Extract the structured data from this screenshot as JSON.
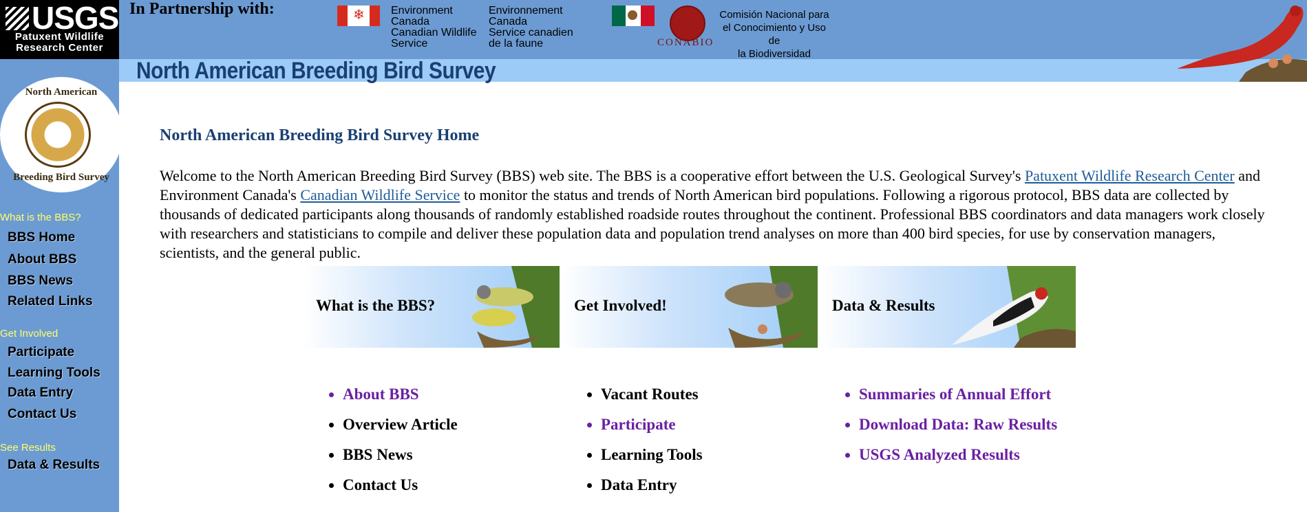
{
  "header": {
    "usgs_logo": "USGS",
    "usgs_sub1": "Patuxent Wildlife",
    "usgs_sub2": "Research Center",
    "partnership": "In Partnership with:",
    "env_canada_en": [
      "Environment",
      "Canada",
      "Canadian Wildlife",
      "Service"
    ],
    "env_canada_fr": [
      "Environnement",
      "Canada",
      "Service canadien",
      "de la faune"
    ],
    "conabio": "CONABIO",
    "comision": [
      "Comisión Nacional para",
      "el Conocimiento y Uso de",
      "la Biodiversidad"
    ],
    "site_title": "North American Breeding Bird Survey"
  },
  "sidebar": {
    "logo_top": "North American",
    "logo_bottom": "Breeding Bird Survey",
    "sections": [
      {
        "heading": "What is the BBS?",
        "items": [
          "BBS Home",
          "About BBS",
          "BBS News",
          "Related Links"
        ]
      },
      {
        "heading": "Get Involved",
        "items": [
          "Participate",
          "Learning Tools",
          "Data Entry",
          "Contact Us"
        ]
      },
      {
        "heading": "See Results",
        "items": [
          "Data & Results"
        ]
      }
    ]
  },
  "main": {
    "heading": "North American Breeding Bird Survey Home",
    "intro_1": "Welcome to the North American Breeding Bird Survey (BBS) web site. The BBS is a cooperative effort between the U.S. Geological Survey's ",
    "link_patuxent": "Patuxent Wildlife Research Center",
    "intro_2": " and Environment Canada's ",
    "link_cws": "Canadian Wildlife Service",
    "intro_3": " to monitor the status and trends of North American bird populations. Following a rigorous protocol, BBS data are collected by thousands of dedicated participants along thousands of randomly established roadside routes throughout the continent. Professional BBS coordinators and data managers work closely with researchers and statisticians to compile and deliver these population data and population trend analyses on more than 400 bird species, for use by conservation managers, scientists, and the general public.",
    "banners": [
      "What is the BBS?",
      "Get Involved!",
      "Data & Results"
    ],
    "columns": [
      [
        {
          "label": "About BBS",
          "visited": true
        },
        {
          "label": "Overview Article",
          "visited": false
        },
        {
          "label": "BBS News",
          "visited": false
        },
        {
          "label": "Contact Us",
          "visited": false
        }
      ],
      [
        {
          "label": "Vacant Routes",
          "visited": false
        },
        {
          "label": "Participate",
          "visited": true
        },
        {
          "label": "Learning Tools",
          "visited": false
        },
        {
          "label": "Data Entry",
          "visited": false
        }
      ],
      [
        {
          "label": "Summaries of Annual Effort",
          "visited": true
        },
        {
          "label": "Download Data: Raw Results",
          "visited": true
        },
        {
          "label": "USGS Analyzed Results",
          "visited": true
        }
      ]
    ]
  }
}
